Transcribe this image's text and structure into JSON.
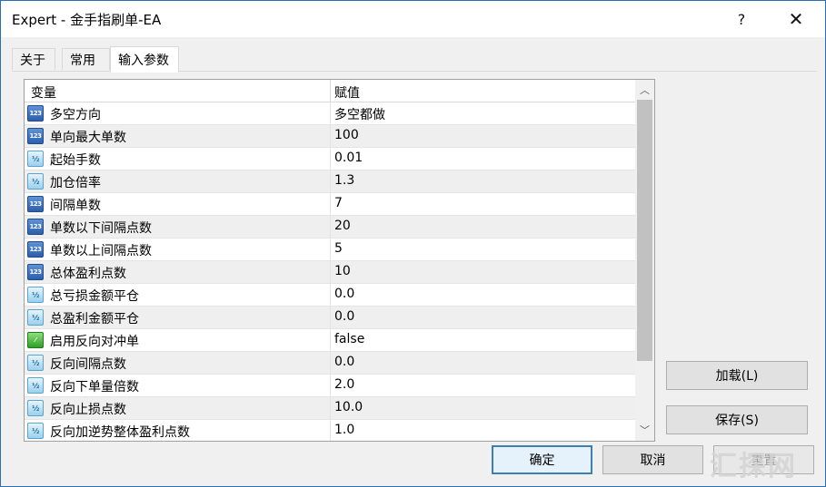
{
  "window": {
    "title": "Expert - 金手指刷单-EA",
    "help_label": "?",
    "close_label": "✕"
  },
  "tabs": [
    {
      "label": "关于"
    },
    {
      "label": "常用"
    },
    {
      "label": "输入参数"
    }
  ],
  "grid": {
    "headers": {
      "variable": "变量",
      "value": "赋值"
    },
    "rows": [
      {
        "icon": "int-icon",
        "badge": "123",
        "name": "多空方向",
        "value": "多空都做"
      },
      {
        "icon": "int-icon",
        "badge": "123",
        "name": "单向最大单数",
        "value": "100"
      },
      {
        "icon": "double-icon",
        "badge": "½",
        "name": "起始手数",
        "value": "0.01"
      },
      {
        "icon": "double-icon",
        "badge": "½",
        "name": "加仓倍率",
        "value": "1.3"
      },
      {
        "icon": "int-icon",
        "badge": "123",
        "name": "间隔单数",
        "value": "7"
      },
      {
        "icon": "int-icon",
        "badge": "123",
        "name": "单数以下间隔点数",
        "value": "20"
      },
      {
        "icon": "int-icon",
        "badge": "123",
        "name": "单数以上间隔点数",
        "value": "5"
      },
      {
        "icon": "int-icon",
        "badge": "123",
        "name": "总体盈利点数",
        "value": "10"
      },
      {
        "icon": "double-icon",
        "badge": "½",
        "name": "总亏损金额平仓",
        "value": "0.0"
      },
      {
        "icon": "double-icon",
        "badge": "½",
        "name": "总盈利金额平仓",
        "value": "0.0"
      },
      {
        "icon": "bool-icon",
        "badge": "⁄",
        "name": "启用反向对冲单",
        "value": "false"
      },
      {
        "icon": "double-icon",
        "badge": "½",
        "name": "反向间隔点数",
        "value": "0.0"
      },
      {
        "icon": "double-icon",
        "badge": "½",
        "name": "反向下单量倍数",
        "value": "2.0"
      },
      {
        "icon": "double-icon",
        "badge": "½",
        "name": "反向止损点数",
        "value": "10.0"
      },
      {
        "icon": "double-icon",
        "badge": "½",
        "name": "反向加逆势整体盈利点数",
        "value": "1.0"
      }
    ],
    "scroll_up": "︿",
    "scroll_down": "﹀"
  },
  "buttons": {
    "load": "加载(L)",
    "save": "保存(S)",
    "ok": "确定",
    "cancel": "取消",
    "reset": "重置"
  },
  "watermark": "汇探网"
}
